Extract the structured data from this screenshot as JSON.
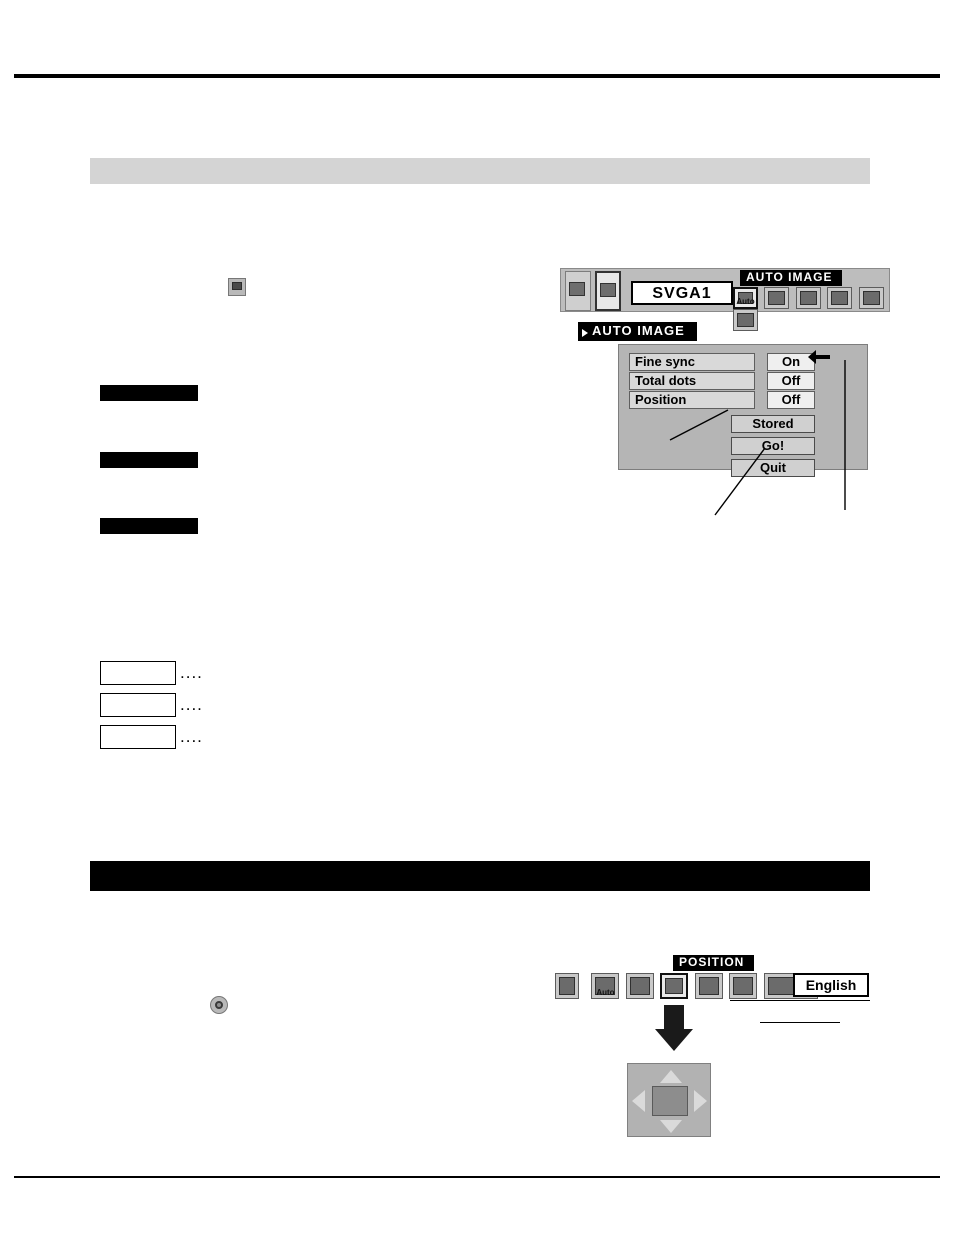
{
  "page": {
    "rule_top": true,
    "rule_bottom": true
  },
  "sections": {
    "auto_image": {
      "band_style": "grey",
      "label": ""
    },
    "position": {
      "band_style": "black",
      "label": ""
    }
  },
  "body_tags": [
    {
      "name": "tag-1",
      "label": ""
    },
    {
      "name": "tag-2",
      "label": ""
    },
    {
      "name": "tag-3",
      "label": ""
    }
  ],
  "frame_boxes": [
    {
      "label": "",
      "dots": "...."
    },
    {
      "label": "",
      "dots": "...."
    },
    {
      "label": "",
      "dots": "...."
    }
  ],
  "osd_auto_image": {
    "menu_title": "AUTO IMAGE",
    "panel_title": "AUTO IMAGE",
    "input_value": "SVGA1",
    "icons": [
      {
        "name": "auto-image-icon",
        "label": "Auto",
        "selected": true
      },
      {
        "name": "image-adjust-icon",
        "label": "",
        "selected": false
      },
      {
        "name": "position-icon",
        "label": "",
        "selected": false
      },
      {
        "name": "pc-adjust-icon",
        "label": "",
        "selected": false
      },
      {
        "name": "screen-icon",
        "label": "",
        "selected": false
      },
      {
        "name": "language-icon",
        "label": "",
        "selected": false
      }
    ],
    "rows": [
      {
        "label": "Fine sync",
        "value": "On"
      },
      {
        "label": "Total dots",
        "value": "Off"
      },
      {
        "label": "Position",
        "value": "Off"
      }
    ],
    "buttons": [
      {
        "label": "Stored"
      },
      {
        "label": "Go!"
      },
      {
        "label": "Quit"
      }
    ]
  },
  "osd_position": {
    "menu_title": "POSITION",
    "language_value": "English",
    "icons": [
      {
        "name": "input-icon",
        "label": "",
        "selected": false
      },
      {
        "name": "auto-image-icon",
        "label": "Auto",
        "selected": false
      },
      {
        "name": "image-adjust-icon",
        "label": "",
        "selected": false
      },
      {
        "name": "position-icon",
        "label": "",
        "selected": true
      },
      {
        "name": "pc-adjust-icon",
        "label": "",
        "selected": false
      },
      {
        "name": "screen-icon",
        "label": "",
        "selected": false
      },
      {
        "name": "language-icon",
        "label": "",
        "selected": false
      }
    ],
    "pad": {
      "up": "▲",
      "down": "▼",
      "left": "◀",
      "right": "▶"
    }
  }
}
